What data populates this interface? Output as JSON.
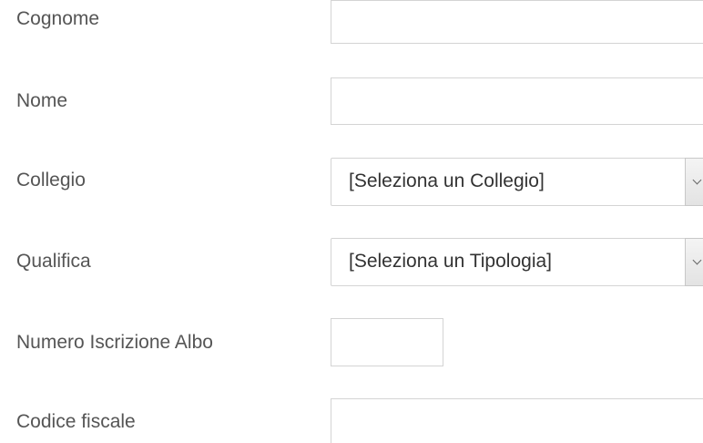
{
  "form": {
    "cognome": {
      "label": "Cognome",
      "value": ""
    },
    "nome": {
      "label": "Nome",
      "value": ""
    },
    "collegio": {
      "label": "Collegio",
      "selected": "[Seleziona un Collegio]"
    },
    "qualifica": {
      "label": "Qualifica",
      "selected": "[Seleziona un Tipologia]"
    },
    "numero_iscrizione_albo": {
      "label": "Numero Iscrizione Albo",
      "value": ""
    },
    "codice_fiscale": {
      "label": "Codice fiscale",
      "value": ""
    }
  }
}
